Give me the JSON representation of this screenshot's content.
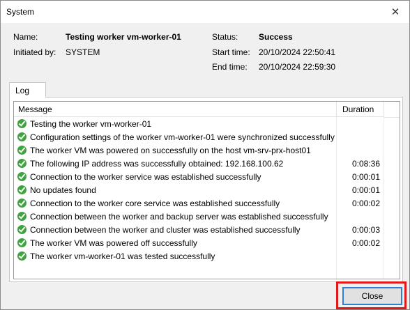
{
  "window": {
    "title": "System"
  },
  "info": {
    "name_label": "Name:",
    "name_value": "Testing worker vm-worker-01",
    "initiated_label": "Initiated by:",
    "initiated_value": "SYSTEM",
    "status_label": "Status:",
    "status_value": "Success",
    "start_label": "Start time:",
    "start_value": "20/10/2024 22:50:41",
    "end_label": "End time:",
    "end_value": "20/10/2024 22:59:30"
  },
  "tab": {
    "label": "Log"
  },
  "log": {
    "columns": [
      "Message",
      "Duration"
    ],
    "rows": [
      {
        "icon": "success-check-icon",
        "message": "Testing the worker vm-worker-01",
        "duration": ""
      },
      {
        "icon": "success-check-icon",
        "message": "Configuration settings of the worker vm-worker-01 were synchronized successfully",
        "duration": ""
      },
      {
        "icon": "success-check-icon",
        "message": "The worker VM was powered on successfully on the host vm-srv-prx-host01",
        "duration": ""
      },
      {
        "icon": "success-check-icon",
        "message": "The following IP address was successfully obtained: 192.168.100.62",
        "duration": "0:08:36"
      },
      {
        "icon": "success-check-icon",
        "message": "Connection to the worker service was established successfully",
        "duration": "0:00:01"
      },
      {
        "icon": "success-check-icon",
        "message": "No updates found",
        "duration": "0:00:01"
      },
      {
        "icon": "success-check-icon",
        "message": "Connection to the worker core service was established successfully",
        "duration": "0:00:02"
      },
      {
        "icon": "success-check-icon",
        "message": "Connection between the worker and backup server was established successfully",
        "duration": ""
      },
      {
        "icon": "success-check-icon",
        "message": "Connection between the worker and cluster was established successfully",
        "duration": "0:00:03"
      },
      {
        "icon": "success-check-icon",
        "message": "The worker VM was powered off successfully",
        "duration": "0:00:02"
      },
      {
        "icon": "success-check-icon",
        "message": "The worker vm-worker-01 was tested successfully",
        "duration": ""
      }
    ]
  },
  "buttons": {
    "close_label": "Close"
  },
  "colors": {
    "success": "#3fa33f",
    "highlight": "#e01a1a",
    "focus": "#2f7fd6"
  }
}
